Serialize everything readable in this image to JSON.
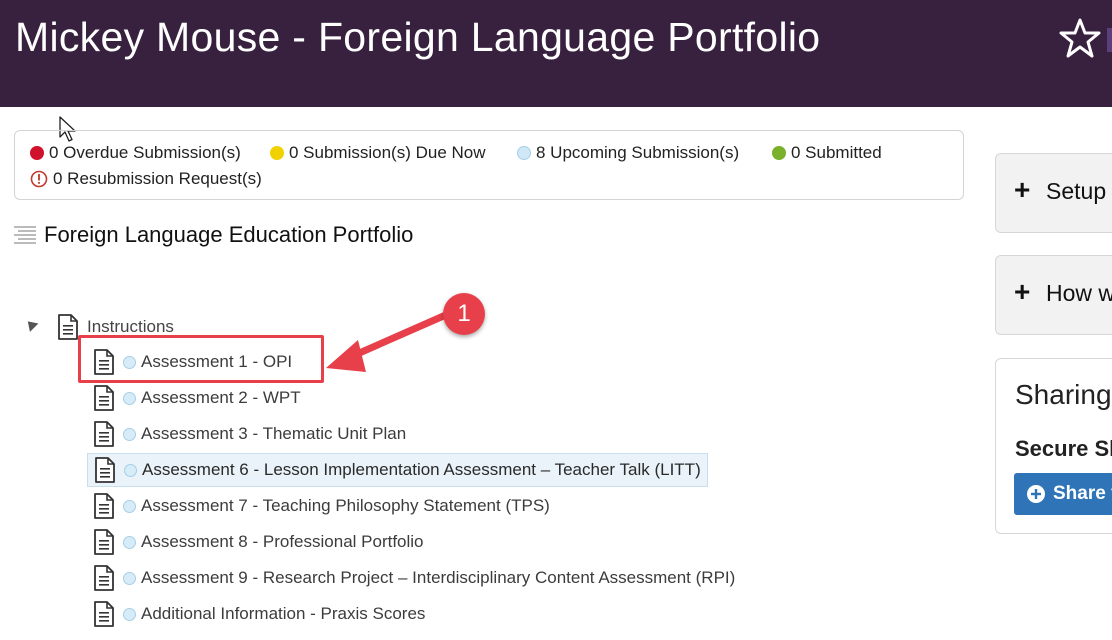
{
  "header": {
    "title": "Mickey Mouse - Foreign Language Portfolio"
  },
  "status": {
    "overdue": "0 Overdue Submission(s)",
    "due_now": "0 Submission(s) Due Now",
    "upcoming": "8 Upcoming Submission(s)",
    "submitted": "0 Submitted",
    "resubmission": "0 Resubmission Request(s)",
    "colors": {
      "overdue": "#d0112b",
      "due_now": "#f2d100",
      "upcoming": "#cfe8f7",
      "submitted": "#7ab02c",
      "resubmission": "#c0392b"
    }
  },
  "portfolio": {
    "title": "Foreign Language Education Portfolio",
    "root": {
      "label": "Instructions",
      "icon": "document-icon",
      "expanded": true
    },
    "items": [
      {
        "label": "Assessment 1 - OPI"
      },
      {
        "label": "Assessment 2 - WPT"
      },
      {
        "label": "Assessment 3 - Thematic Unit Plan"
      },
      {
        "label": "Assessment 6 - Lesson Implementation Assessment – Teacher Talk (LITT)"
      },
      {
        "label": "Assessment 7 - Teaching Philosophy Statement (TPS)"
      },
      {
        "label": "Assessment 8 - Professional Portfolio"
      },
      {
        "label": "Assessment 9 - Research Project – Interdisciplinary Content Assessment (RPI)"
      },
      {
        "label": "Additional Information - Praxis Scores"
      }
    ]
  },
  "annotation": {
    "badge": "1",
    "color": "#e8404a"
  },
  "sidebar": {
    "setup_label": "Setup",
    "how_label": "How w",
    "sharing_title": "Sharing",
    "secure_label": "Secure Sh",
    "share_button_label": "Share t"
  }
}
